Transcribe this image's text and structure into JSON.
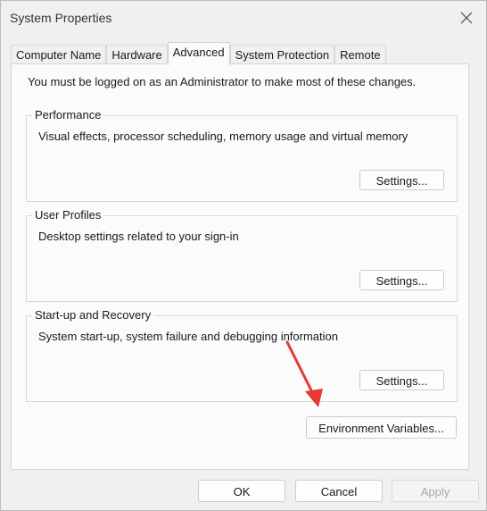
{
  "window": {
    "title": "System Properties",
    "close_icon": "close-icon"
  },
  "tabs": [
    {
      "label": "Computer Name"
    },
    {
      "label": "Hardware"
    },
    {
      "label": "Advanced"
    },
    {
      "label": "System Protection"
    },
    {
      "label": "Remote"
    }
  ],
  "active_tab": "Advanced",
  "advanced": {
    "admin_note": "You must be logged on as an Administrator to make most of these changes.",
    "performance": {
      "title": "Performance",
      "description": "Visual effects, processor scheduling, memory usage and virtual memory",
      "button": "Settings..."
    },
    "user_profiles": {
      "title": "User Profiles",
      "description": "Desktop settings related to your sign-in",
      "button": "Settings..."
    },
    "startup_recovery": {
      "title": "Start-up and Recovery",
      "description": "System start-up, system failure and debugging information",
      "button": "Settings..."
    },
    "environment_variables_button": "Environment Variables..."
  },
  "footer": {
    "ok": "OK",
    "cancel": "Cancel",
    "apply": "Apply"
  },
  "annotation": {
    "arrow_color": "#e53935",
    "points_to": "Environment Variables..."
  }
}
